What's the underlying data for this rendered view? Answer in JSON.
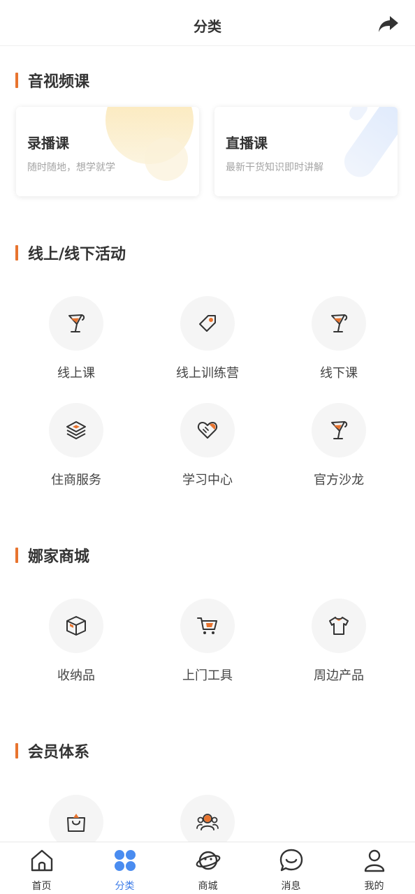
{
  "header": {
    "title": "分类",
    "share_icon": "share-arrow-icon"
  },
  "sections": {
    "av": {
      "title": "音视频课"
    },
    "activity": {
      "title": "线上/线下活动"
    },
    "mall": {
      "title": "娜家商城"
    },
    "member": {
      "title": "会员体系"
    }
  },
  "courses": [
    {
      "title": "录播课",
      "subtitle": "随时随地，想学就学"
    },
    {
      "title": "直播课",
      "subtitle": "最新干货知识即时讲解"
    }
  ],
  "activities": [
    {
      "label": "线上课",
      "icon": "wine-glass-icon"
    },
    {
      "label": "线上训练营",
      "icon": "tag-icon"
    },
    {
      "label": "线下课",
      "icon": "wine-glass-icon"
    },
    {
      "label": "住商服务",
      "icon": "layers-icon"
    },
    {
      "label": "学习中心",
      "icon": "heart-hands-icon"
    },
    {
      "label": "官方沙龙",
      "icon": "wine-glass-icon"
    }
  ],
  "mall_items": [
    {
      "label": "收纳品",
      "icon": "box-icon"
    },
    {
      "label": "上门工具",
      "icon": "cart-icon"
    },
    {
      "label": "周边产品",
      "icon": "tshirt-icon"
    }
  ],
  "member_items": [
    {
      "label": "",
      "icon": "shopping-bag-icon"
    },
    {
      "label": "",
      "icon": "people-icon"
    }
  ],
  "tabbar": [
    {
      "label": "首页",
      "icon": "home-icon",
      "active": false
    },
    {
      "label": "分类",
      "icon": "category-icon",
      "active": true
    },
    {
      "label": "商城",
      "icon": "planet-icon",
      "active": false
    },
    {
      "label": "消息",
      "icon": "chat-icon",
      "active": false
    },
    {
      "label": "我的",
      "icon": "user-icon",
      "active": false
    }
  ],
  "colors": {
    "accent": "#e8742f",
    "active_tab": "#3b7be8",
    "text": "#333333"
  }
}
